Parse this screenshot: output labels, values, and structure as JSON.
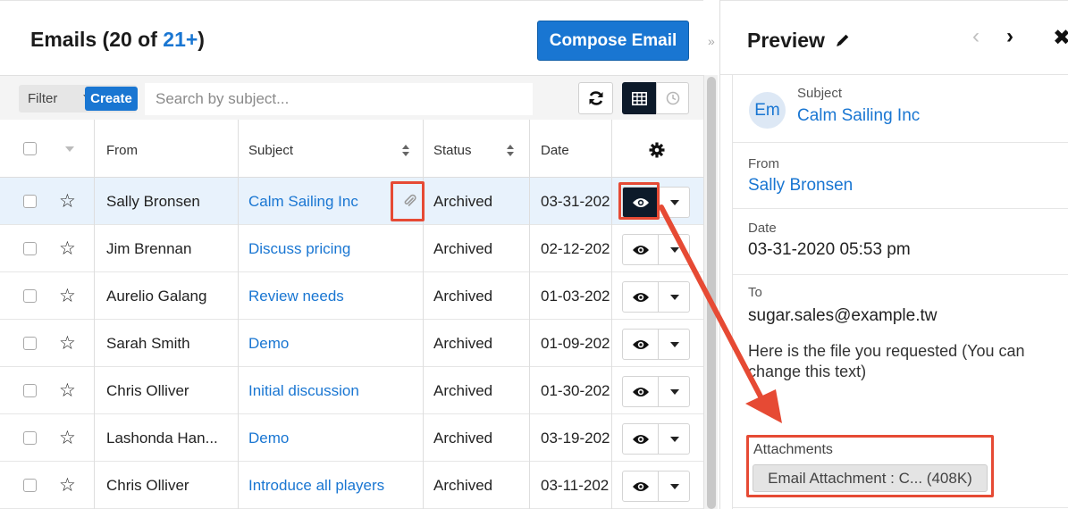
{
  "list": {
    "title_prefix": "Emails (20 of ",
    "title_link": "21+",
    "title_suffix": ")",
    "compose_label": "Compose Email",
    "collapse_glyph": "»"
  },
  "toolbar": {
    "filter_label": "Filter",
    "create_label": "Create",
    "search_placeholder": "Search by subject...",
    "icons": [
      "refresh-icon",
      "list-view-icon",
      "activity-stream-icon"
    ]
  },
  "columns": {
    "from": "From",
    "subject": "Subject",
    "status": "Status",
    "date": "Date",
    "settings_icon": "gear-icon"
  },
  "rows": [
    {
      "from": "Sally Bronsen",
      "subject": "Calm Sailing Inc",
      "status": "Archived",
      "date": "03-31-202",
      "attachment": true,
      "selected": true
    },
    {
      "from": "Jim Brennan",
      "subject": "Discuss pricing",
      "status": "Archived",
      "date": "02-12-202"
    },
    {
      "from": "Aurelio Galang",
      "subject": "Review needs",
      "status": "Archived",
      "date": "01-03-202"
    },
    {
      "from": "Sarah Smith",
      "subject": "Demo",
      "status": "Archived",
      "date": "01-09-202"
    },
    {
      "from": "Chris Olliver",
      "subject": "Initial discussion",
      "status": "Archived",
      "date": "01-30-202"
    },
    {
      "from": "Lashonda Han...",
      "subject": "Demo",
      "status": "Archived",
      "date": "03-19-202"
    },
    {
      "from": "Chris Olliver",
      "subject": "Introduce all players",
      "status": "Archived",
      "date": "03-11-202"
    }
  ],
  "preview": {
    "title": "Preview",
    "avatar": "Em",
    "subject_label": "Subject",
    "subject": "Calm Sailing Inc",
    "from_label": "From",
    "from": "Sally Bronsen",
    "date_label": "Date",
    "date": "03-31-2020 05:53 pm",
    "to_label": "To",
    "to": "sugar.sales@example.tw",
    "body": "Here is the file you requested (You can change this text)",
    "attachments_label": "Attachments",
    "attachment": "Email Attachment : C... (408K)",
    "nav_prev": "‹",
    "nav_next": "›",
    "close": "✖"
  },
  "colors": {
    "accent": "#1976d2",
    "highlight": "#e64a34",
    "dark_button": "#0d1a2a",
    "selected_row": "#e8f2fc"
  }
}
